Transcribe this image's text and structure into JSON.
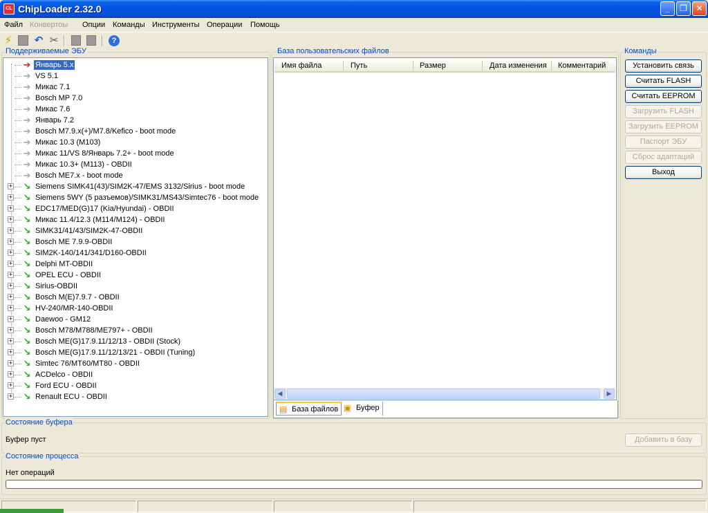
{
  "window": {
    "title": "ChipLoader 2.32.0",
    "icon_text": "CL",
    "minimize": "_",
    "maximize": "❐",
    "close": "✕"
  },
  "menu": [
    {
      "label": "Файл",
      "enabled": true
    },
    {
      "label": "Конвертоы",
      "enabled": false
    },
    {
      "label": "Опции",
      "enabled": true
    },
    {
      "label": "Команды",
      "enabled": true
    },
    {
      "label": "Инструменты",
      "enabled": true
    },
    {
      "label": "Операции",
      "enabled": true
    },
    {
      "label": "Помощь",
      "enabled": true
    }
  ],
  "toolbar_icons": [
    "open-icon",
    "save-icon",
    "undo-icon",
    "tools-icon",
    "copy-icon",
    "paste-icon",
    "help-icon"
  ],
  "tree": {
    "title": "Поддерживаемые ЭБУ",
    "items": [
      {
        "label": "Январь 5.x",
        "kind": "leaf",
        "selected": true
      },
      {
        "label": "VS 5.1",
        "kind": "leaf"
      },
      {
        "label": "Микас 7.1",
        "kind": "leaf"
      },
      {
        "label": "Bosch MP 7.0",
        "kind": "leaf"
      },
      {
        "label": "Микас 7.6",
        "kind": "leaf"
      },
      {
        "label": "Январь 7.2",
        "kind": "leaf"
      },
      {
        "label": "Bosch M7.9.x(+)/M7.8/Kefico - boot mode",
        "kind": "leaf"
      },
      {
        "label": "Микас 10.3 (M103)",
        "kind": "leaf"
      },
      {
        "label": "Микас 11/VS 8/Январь 7.2+ - boot mode",
        "kind": "leaf"
      },
      {
        "label": "Микас 10.3+ (M113) - OBDII",
        "kind": "leaf"
      },
      {
        "label": "Bosch ME7.x - boot mode",
        "kind": "leaf"
      },
      {
        "label": "Siemens SIMK41(43)/SIM2K-47/EMS 3132/Sirius - boot mode",
        "kind": "group"
      },
      {
        "label": "Siemens 5WY (5 разъемов)/SIMK31/MS43/Simtec76 - boot mode",
        "kind": "group"
      },
      {
        "label": "EDC17/MED(G)17 (Kia/Hyundai) - OBDII",
        "kind": "group"
      },
      {
        "label": "Микас 11.4/12.3 (M114/M124) - OBDII",
        "kind": "group"
      },
      {
        "label": "SIMK31/41/43/SIM2K-47-OBDII",
        "kind": "group"
      },
      {
        "label": "Bosch ME 7.9.9-OBDII",
        "kind": "group"
      },
      {
        "label": "SIM2K-140/141/341/D160-OBDII",
        "kind": "group"
      },
      {
        "label": "Delphi MT-OBDII",
        "kind": "group"
      },
      {
        "label": "OPEL ECU - OBDII",
        "kind": "group"
      },
      {
        "label": "Sirius-OBDII",
        "kind": "group"
      },
      {
        "label": "Bosch M(E)7.9.7 - OBDII",
        "kind": "group"
      },
      {
        "label": "HV-240/MR-140-OBDII",
        "kind": "group"
      },
      {
        "label": "Daewoo - GM12",
        "kind": "group"
      },
      {
        "label": "Bosch M78/M788/ME797+ - OBDII",
        "kind": "group"
      },
      {
        "label": "Bosch ME(G)17.9.11/12/13 - OBDII (Stock)",
        "kind": "group"
      },
      {
        "label": "Bosch ME(G)17.9.11/12/13/21 - OBDII (Tuning)",
        "kind": "group"
      },
      {
        "label": "Simtec 76/MT60/MT80 - OBDII",
        "kind": "group"
      },
      {
        "label": "ACDelco - OBDII",
        "kind": "group"
      },
      {
        "label": "Ford ECU - OBDII",
        "kind": "group"
      },
      {
        "label": "Renault ECU - OBDII",
        "kind": "group"
      }
    ]
  },
  "files": {
    "title": "База пользовательских файлов",
    "columns": [
      "Имя файла",
      "Путь",
      "Размер",
      "Дата изменения",
      "Комментарий"
    ],
    "tabs": [
      "База файлов",
      "Буфер"
    ]
  },
  "commands": {
    "title": "Команды",
    "buttons": [
      {
        "label": "Установить связь",
        "enabled": true
      },
      {
        "label": "Считать FLASH",
        "enabled": true
      },
      {
        "label": "Считать EEPROM",
        "enabled": true
      },
      {
        "label": "Загрузить FLASH",
        "enabled": false
      },
      {
        "label": "Загрузить EEPROM",
        "enabled": false
      },
      {
        "label": "Паспорт ЭБУ",
        "enabled": false
      },
      {
        "label": "Сброс адаптаций",
        "enabled": false
      },
      {
        "label": "Выход",
        "enabled": true
      }
    ]
  },
  "buffer": {
    "title": "Состояние буфера",
    "status": "Буфер пуст",
    "add_button": "Добавить в базу"
  },
  "process": {
    "title": "Состояние процесса",
    "status": "Нет операций",
    "progress": 0
  },
  "colors": {
    "accent": "#0046D5",
    "selection": "#316AC5",
    "face": "#ECE9D8"
  }
}
